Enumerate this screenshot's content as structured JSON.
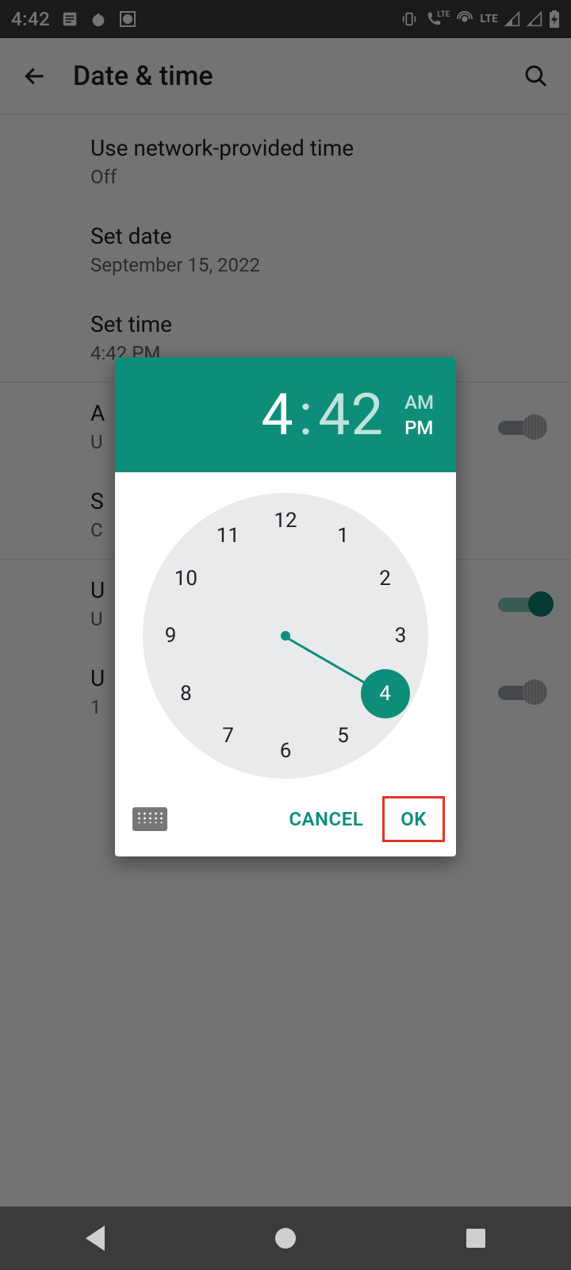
{
  "status": {
    "time": "4:42",
    "lte_label": "LTE"
  },
  "header": {
    "title": "Date & time"
  },
  "settings": {
    "network_time": {
      "title": "Use network-provided time",
      "value": "Off"
    },
    "set_date": {
      "title": "Set date",
      "value": "September 15, 2022"
    },
    "set_time": {
      "title": "Set time",
      "value": "4:42 PM"
    },
    "auto_tz": {
      "title": "A",
      "value": "U"
    },
    "set_tz": {
      "title": "S",
      "value": "C"
    },
    "use_locale": {
      "title": "U",
      "value": "U"
    },
    "use_24h": {
      "title": "U",
      "value": "1"
    }
  },
  "dialog": {
    "hour": "4",
    "minute": "42",
    "am": "AM",
    "pm": "PM",
    "selected_period": "PM",
    "selected_hour": 4,
    "hours": [
      "12",
      "1",
      "2",
      "3",
      "4",
      "5",
      "6",
      "7",
      "8",
      "9",
      "10",
      "11"
    ],
    "cancel": "CANCEL",
    "ok": "OK"
  },
  "colors": {
    "accent": "#0e8e7a"
  }
}
